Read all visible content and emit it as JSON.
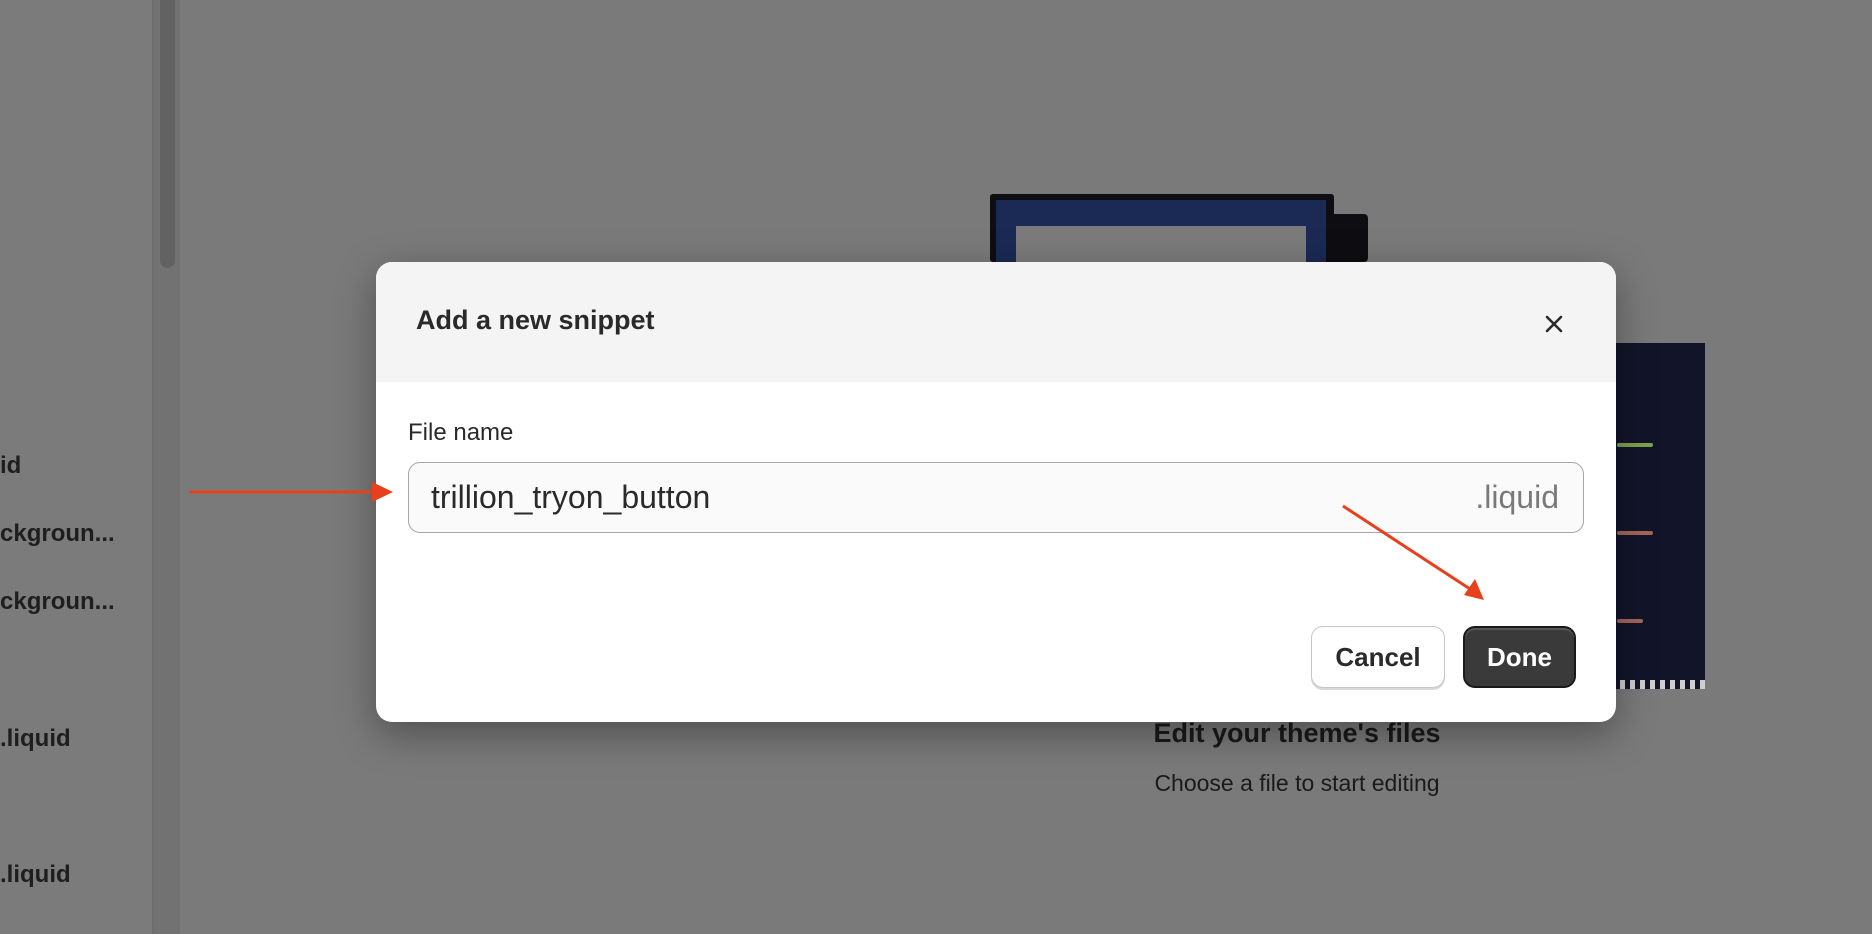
{
  "sidebar": {
    "items": [
      {
        "label": "id"
      },
      {
        "label": "ckgroun..."
      },
      {
        "label": "ckgroun..."
      },
      {
        "label": ".liquid"
      },
      {
        "label": ".liquid"
      }
    ]
  },
  "empty_state": {
    "title": "Edit your theme's files",
    "subtitle": "Choose a file to start editing"
  },
  "modal": {
    "title": "Add a new snippet",
    "field_label": "File name",
    "file_name_value": "trillion_tryon_button",
    "file_suffix": ".liquid",
    "cancel_label": "Cancel",
    "done_label": "Done"
  },
  "colors": {
    "annotation_arrow": "#e8401c",
    "primary_button": "#3a3a3a",
    "overlay": "#7a7a7a"
  },
  "icons": {
    "close": "close-icon"
  }
}
